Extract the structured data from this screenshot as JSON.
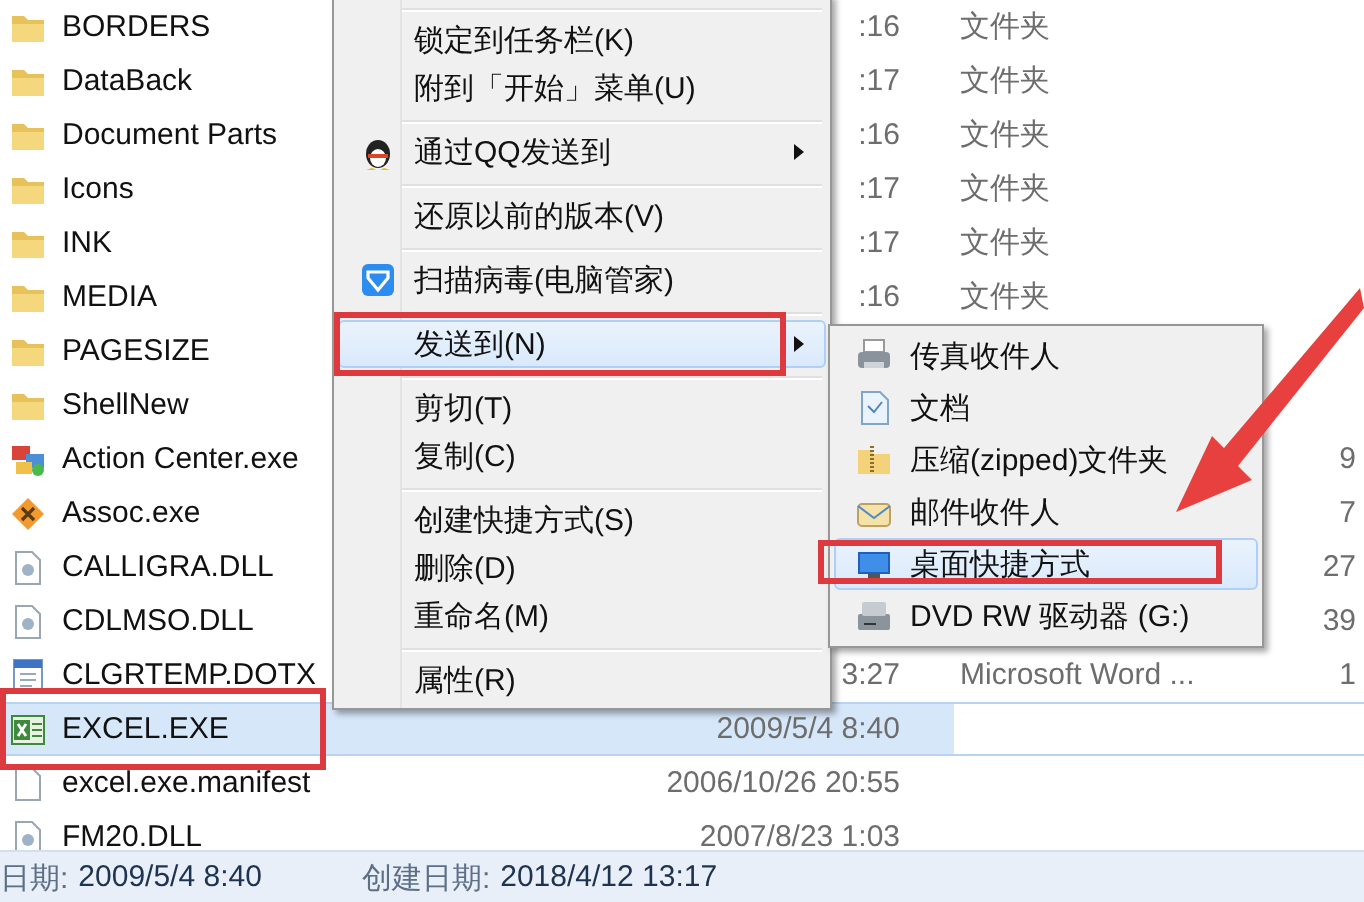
{
  "file_list": {
    "rows": [
      {
        "kind": "folder",
        "name": "BORDERS",
        "date": ":16",
        "type": "文件夹",
        "size": "",
        "selected": false,
        "outlined": false
      },
      {
        "kind": "folder",
        "name": "DataBack",
        "date": ":17",
        "type": "文件夹",
        "size": "",
        "selected": false,
        "outlined": false
      },
      {
        "kind": "folder",
        "name": "Document Parts",
        "date": ":16",
        "type": "文件夹",
        "size": "",
        "selected": false,
        "outlined": false
      },
      {
        "kind": "folder",
        "name": "Icons",
        "date": ":17",
        "type": "文件夹",
        "size": "",
        "selected": false,
        "outlined": false
      },
      {
        "kind": "folder",
        "name": "INK",
        "date": ":17",
        "type": "文件夹",
        "size": "",
        "selected": false,
        "outlined": false
      },
      {
        "kind": "folder",
        "name": "MEDIA",
        "date": ":16",
        "type": "文件夹",
        "size": "",
        "selected": false,
        "outlined": false
      },
      {
        "kind": "folder",
        "name": "PAGESIZE",
        "date": "",
        "type": "",
        "size": "",
        "selected": false,
        "outlined": false
      },
      {
        "kind": "folder",
        "name": "ShellNew",
        "date": "",
        "type": "",
        "size": "",
        "selected": false,
        "outlined": false
      },
      {
        "kind": "app",
        "name": "Action Center.exe",
        "date": "",
        "type": "",
        "size": "9",
        "selected": false,
        "outlined": false
      },
      {
        "kind": "setup",
        "name": "Assoc.exe",
        "date": "",
        "type": "",
        "size": "7",
        "selected": false,
        "outlined": false
      },
      {
        "kind": "dll",
        "name": "CALLIGRA.DLL",
        "date": "",
        "type": "",
        "size": "27",
        "selected": false,
        "outlined": false
      },
      {
        "kind": "dll",
        "name": "CDLMSO.DLL",
        "date": "",
        "type": "",
        "size": "39",
        "selected": false,
        "outlined": false
      },
      {
        "kind": "doc",
        "name": "CLGRTEMP.DOTX",
        "date": "3:27",
        "type": "Microsoft Word ...",
        "size": "1",
        "selected": false,
        "outlined": false
      },
      {
        "kind": "excel",
        "name": "EXCEL.EXE",
        "date": "2009/5/4 8:40",
        "type": "",
        "size": "",
        "selected": true,
        "outlined": true
      },
      {
        "kind": "file",
        "name": "excel.exe.manifest",
        "date": "2006/10/26 20:55",
        "type": "",
        "size": "",
        "selected": false,
        "outlined": false
      },
      {
        "kind": "dll",
        "name": "FM20.DLL",
        "date": "2007/8/23 1:03",
        "type": "",
        "size": "",
        "selected": false,
        "outlined": false
      }
    ]
  },
  "context_menu": {
    "items": [
      {
        "kind": "separator"
      },
      {
        "kind": "plain",
        "label": "锁定到任务栏(K)",
        "submenu": false,
        "selected": false,
        "outlined": false
      },
      {
        "kind": "plain",
        "label": "附到「开始」菜单(U)",
        "submenu": false,
        "selected": false,
        "outlined": false
      },
      {
        "kind": "separator"
      },
      {
        "kind": "penguin",
        "label": "通过QQ发送到",
        "submenu": true,
        "selected": false,
        "outlined": false
      },
      {
        "kind": "separator"
      },
      {
        "kind": "plain",
        "label": "还原以前的版本(V)",
        "submenu": false,
        "selected": false,
        "outlined": false
      },
      {
        "kind": "separator"
      },
      {
        "kind": "shield",
        "label": "扫描病毒(电脑管家)",
        "submenu": false,
        "selected": false,
        "outlined": false
      },
      {
        "kind": "separator"
      },
      {
        "kind": "plain",
        "label": "发送到(N)",
        "submenu": true,
        "selected": true,
        "outlined": true
      },
      {
        "kind": "separator"
      },
      {
        "kind": "plain",
        "label": "剪切(T)",
        "submenu": false,
        "selected": false,
        "outlined": false
      },
      {
        "kind": "plain",
        "label": "复制(C)",
        "submenu": false,
        "selected": false,
        "outlined": false
      },
      {
        "kind": "separator"
      },
      {
        "kind": "plain",
        "label": "创建快捷方式(S)",
        "submenu": false,
        "selected": false,
        "outlined": false
      },
      {
        "kind": "plain",
        "label": "删除(D)",
        "submenu": false,
        "selected": false,
        "outlined": false
      },
      {
        "kind": "plain",
        "label": "重命名(M)",
        "submenu": false,
        "selected": false,
        "outlined": false
      },
      {
        "kind": "separator"
      },
      {
        "kind": "plain",
        "label": "属性(R)",
        "submenu": false,
        "selected": false,
        "outlined": false
      }
    ]
  },
  "send_to_menu": {
    "items": [
      {
        "kind": "fax",
        "label": "传真收件人",
        "selected": false,
        "outlined": false
      },
      {
        "kind": "document",
        "label": "文档",
        "selected": false,
        "outlined": false
      },
      {
        "kind": "zip",
        "label": "压缩(zipped)文件夹",
        "selected": false,
        "outlined": false
      },
      {
        "kind": "mail",
        "label": "邮件收件人",
        "selected": false,
        "outlined": false
      },
      {
        "kind": "desktop",
        "label": "桌面快捷方式",
        "selected": true,
        "outlined": true
      },
      {
        "kind": "dvd",
        "label": "DVD RW 驱动器 (G:)",
        "selected": false,
        "outlined": false
      }
    ]
  },
  "status_bar": {
    "fields": [
      {
        "label": "日期:",
        "value": "2009/5/4 8:40"
      },
      {
        "label": "创建日期:",
        "value": "2018/4/12 13:17"
      }
    ]
  }
}
